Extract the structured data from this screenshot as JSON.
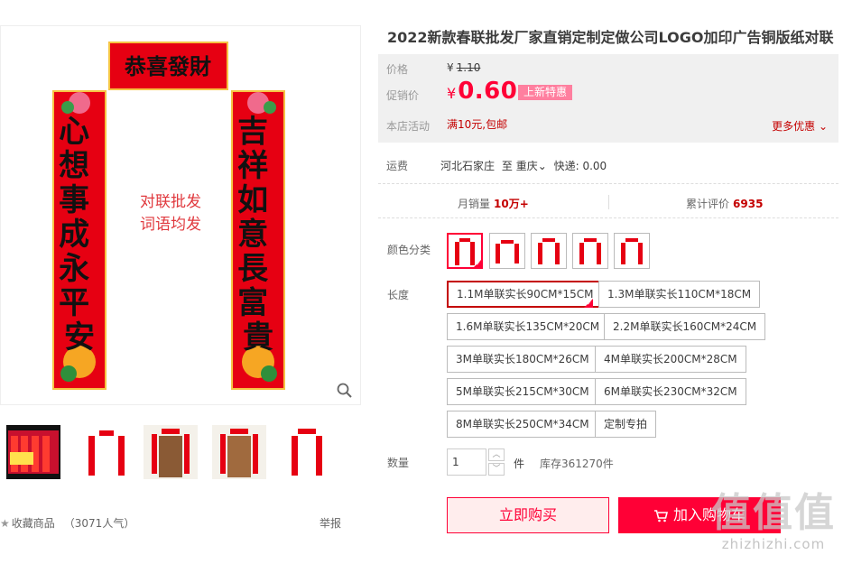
{
  "product": {
    "title": "2022新款春联批发厂家直销定制定做公司LOGO加印广告铜版纸对联"
  },
  "gallery": {
    "main_image": {
      "top_banner": "恭喜發財",
      "left_couplet": "心想事成永平安",
      "right_couplet": "吉祥如意長富貴",
      "center_text_line1": "对联批发",
      "center_text_line2": "词语均发"
    },
    "thumbnail_count": 5,
    "zoom_icon": "magnifier-icon"
  },
  "price": {
    "orig_label": "价格",
    "orig_currency": "¥",
    "orig_value": "1.10",
    "promo_label": "促销价",
    "promo_currency": "¥",
    "promo_value": "0.60",
    "promo_badge": "上新特惠",
    "activity_label": "本店活动",
    "activity_value": "满10元,包邮",
    "more_discount": "更多优惠"
  },
  "shipping": {
    "label": "运费",
    "origin": "河北石家庄",
    "to_word": "至",
    "destination": "重庆",
    "express": "快递: 0.00"
  },
  "stats": {
    "monthly_label": "月销量",
    "monthly_value": "10万+",
    "reviews_label": "累计评价",
    "reviews_value": "6935"
  },
  "options": {
    "color_label": "颜色分类",
    "length_label": "长度",
    "sizes": [
      "1.1M单联实长90CM*15CM",
      "1.3M单联实长110CM*18CM",
      "1.6M单联实长135CM*20CM",
      "2.2M单联实长160CM*24CM",
      "3M单联实长180CM*26CM",
      "4M单联实长200CM*28CM",
      "5M单联实长215CM*30CM",
      "6M单联实长230CM*32CM",
      "8M单联实长250CM*34CM",
      "定制专拍"
    ]
  },
  "quantity": {
    "label": "数量",
    "value": "1",
    "unit": "件",
    "stock": "库存361270件"
  },
  "actions": {
    "buy_now": "立即购买",
    "add_cart": "加入购物车"
  },
  "footer": {
    "favorite": "收藏商品",
    "popularity": "（3071人气）",
    "report": "举报"
  },
  "watermark": {
    "big": "值值值",
    "small": "zhizhizhi.com"
  },
  "colors": {
    "accent": "#ff0036",
    "dark_red": "#c40000",
    "badge_pink": "#ff7f9f",
    "couplet_red": "#e60012"
  }
}
